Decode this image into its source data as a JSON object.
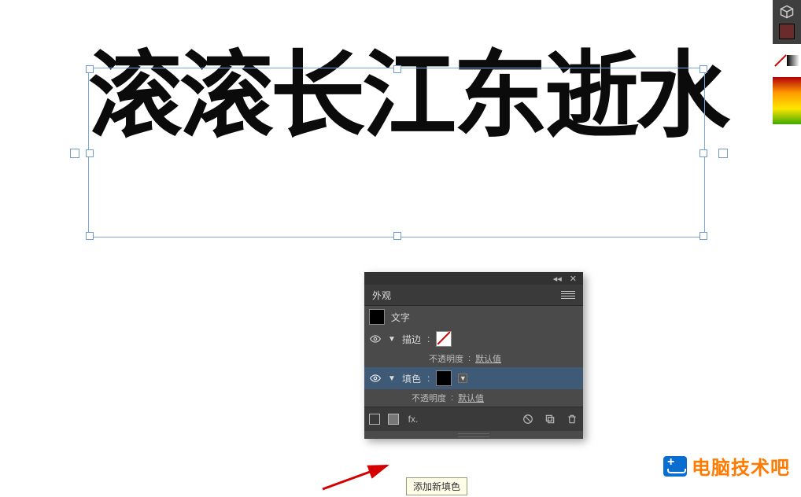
{
  "canvas": {
    "main_text": "滚滚长江东逝水"
  },
  "appearance_panel": {
    "title": "外观",
    "target_label": "文字",
    "stroke": {
      "label": "描边",
      "opacity_label": "不透明度",
      "opacity_value": "默认值"
    },
    "fill": {
      "label": "填色",
      "opacity_label": "不透明度",
      "opacity_value": "默认值"
    },
    "fx_label": "fx.",
    "tooltip_add_fill": "添加新填色"
  },
  "watermark": {
    "text": "电脑技术吧"
  }
}
